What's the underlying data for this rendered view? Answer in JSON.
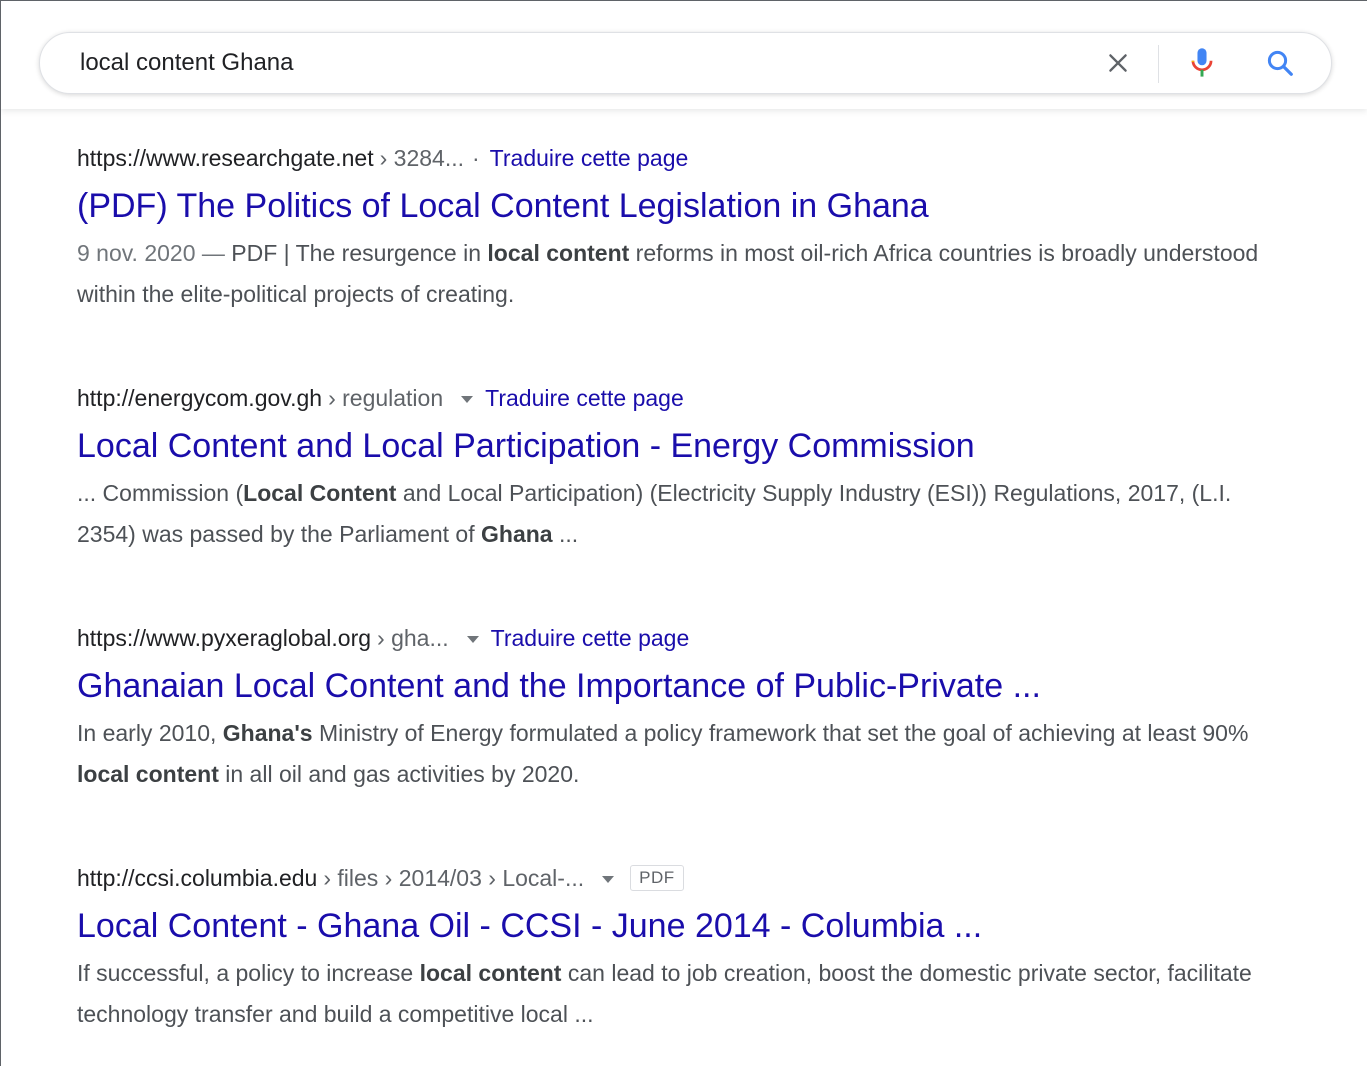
{
  "search": {
    "query": "local content Ghana"
  },
  "icons": {
    "clear": "close-icon",
    "mic": "microphone-icon",
    "search": "search-icon"
  },
  "colors": {
    "link": "#1a0dab",
    "mic_blue": "#4285f4",
    "mic_red": "#ea4335",
    "mic_green": "#34a853",
    "mic_yellow": "#fbbc05"
  },
  "results": [
    {
      "host": "https://www.researchgate.net",
      "path": "› 3284...",
      "separator": "·",
      "translate": "Traduire cette page",
      "title": "(PDF) The Politics of Local Content Legislation in Ghana",
      "snippet_parts": [
        {
          "t": "9 nov. 2020 — ",
          "s": "date"
        },
        {
          "t": "PDF | The resurgence in ",
          "s": "n"
        },
        {
          "t": "local content",
          "s": "b"
        },
        {
          "t": " reforms in most oil-rich Africa countries is broadly understood within the elite-political projects of creating.",
          "s": "n"
        }
      ]
    },
    {
      "host": "http://energycom.gov.gh",
      "path": "› regulation",
      "translate": "Traduire cette page",
      "title": "Local Content and Local Participation - Energy Commission",
      "snippet_parts": [
        {
          "t": "... Commission (",
          "s": "n"
        },
        {
          "t": "Local Content",
          "s": "b"
        },
        {
          "t": " and Local Participation) (Electricity Supply Industry (ESI)) Regulations, 2017, (L.I. 2354) was passed by the Parliament of ",
          "s": "n"
        },
        {
          "t": "Ghana",
          "s": "b"
        },
        {
          "t": " ...",
          "s": "n"
        }
      ]
    },
    {
      "host": "https://www.pyxeraglobal.org",
      "path": "› gha...",
      "translate": "Traduire cette page",
      "title": "Ghanaian Local Content and the Importance of Public-Private ...",
      "snippet_parts": [
        {
          "t": "In early 2010, ",
          "s": "n"
        },
        {
          "t": "Ghana's",
          "s": "b"
        },
        {
          "t": " Ministry of Energy formulated a policy framework that set the goal of achieving at least 90% ",
          "s": "n"
        },
        {
          "t": "local content",
          "s": "b"
        },
        {
          "t": " in all oil and gas activities by 2020.",
          "s": "n"
        }
      ]
    },
    {
      "host": "http://ccsi.columbia.edu",
      "path": "› files › 2014/03 › Local-...",
      "badge": "PDF",
      "title": "Local Content - Ghana Oil - CCSI - June 2014 - Columbia ...",
      "snippet_parts": [
        {
          "t": "If successful, a policy to increase ",
          "s": "n"
        },
        {
          "t": "local content",
          "s": "b"
        },
        {
          "t": " can lead to job creation, boost the domestic private sector, facilitate technology transfer and build a competitive local ...",
          "s": "n"
        }
      ]
    }
  ]
}
